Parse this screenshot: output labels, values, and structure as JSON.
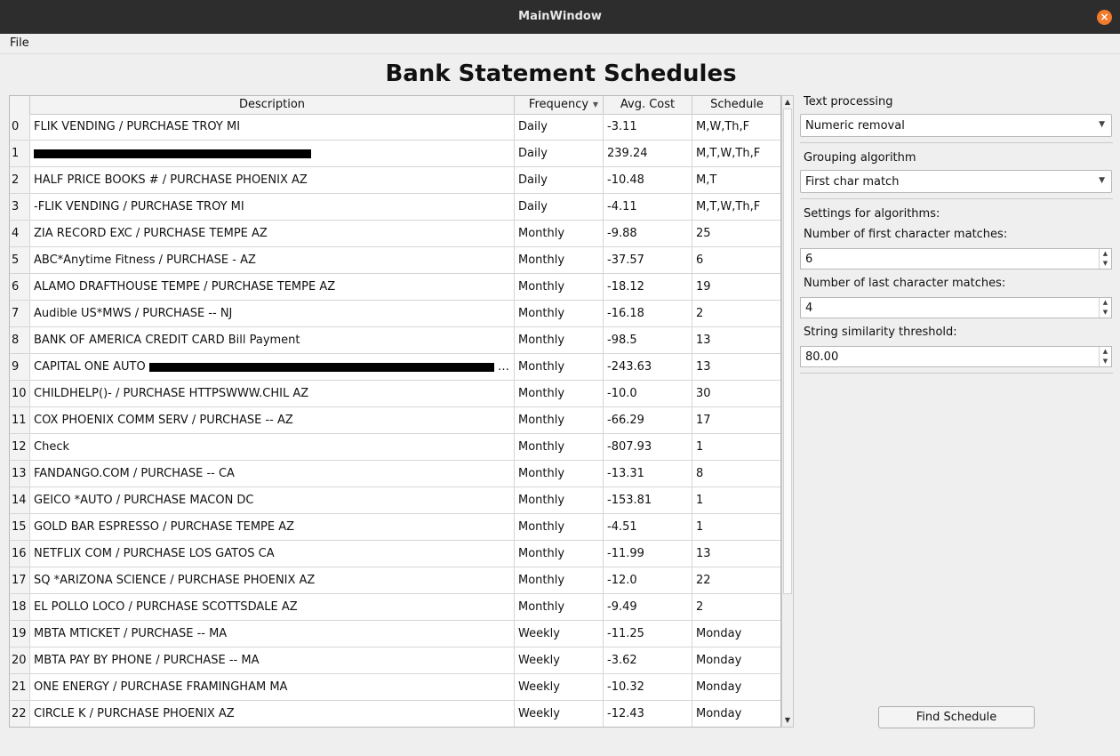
{
  "window": {
    "title": "MainWindow",
    "close_glyph": "×"
  },
  "menu": {
    "file_label": "File"
  },
  "page_title": "Bank Statement Schedules",
  "table": {
    "columns": [
      "Description",
      "Frequency",
      "Avg. Cost",
      "Schedule"
    ],
    "rows": [
      {
        "index": "0",
        "description": "FLIK VENDING / PURCHASE TROY MI",
        "frequency": "Daily",
        "avg_cost": "-3.11",
        "schedule": "M,W,Th,F"
      },
      {
        "index": "1",
        "description": "",
        "frequency": "Daily",
        "avg_cost": "239.24",
        "schedule": "M,T,W,Th,F"
      },
      {
        "index": "2",
        "description": "HALF PRICE BOOKS # / PURCHASE PHOENIX AZ",
        "frequency": "Daily",
        "avg_cost": "-10.48",
        "schedule": "M,T"
      },
      {
        "index": "3",
        "description": "-FLIK VENDING / PURCHASE TROY MI",
        "frequency": "Daily",
        "avg_cost": "-4.11",
        "schedule": "M,T,W,Th,F"
      },
      {
        "index": "4",
        "description": "ZIA RECORD EXC / PURCHASE TEMPE AZ",
        "frequency": "Monthly",
        "avg_cost": "-9.88",
        "schedule": "25"
      },
      {
        "index": "5",
        "description": "ABC*Anytime Fitness / PURCHASE - AZ",
        "frequency": "Monthly",
        "avg_cost": "-37.57",
        "schedule": "6"
      },
      {
        "index": "6",
        "description": "ALAMO DRAFTHOUSE TEMPE / PURCHASE TEMPE AZ",
        "frequency": "Monthly",
        "avg_cost": "-18.12",
        "schedule": "19"
      },
      {
        "index": "7",
        "description": "Audible US*MWS / PURCHASE -- NJ",
        "frequency": "Monthly",
        "avg_cost": "-16.18",
        "schedule": "2"
      },
      {
        "index": "8",
        "description": "BANK OF AMERICA CREDIT CARD Bill Payment",
        "frequency": "Monthly",
        "avg_cost": "-98.5",
        "schedule": "13"
      },
      {
        "index": "9",
        "description": "CAPITAL ONE AUTO",
        "frequency": "Monthly",
        "avg_cost": "-243.63",
        "schedule": "13"
      },
      {
        "index": "10",
        "description": "CHILDHELP()- / PURCHASE HTTPSWWW.CHIL AZ",
        "frequency": "Monthly",
        "avg_cost": "-10.0",
        "schedule": "30"
      },
      {
        "index": "11",
        "description": "COX PHOENIX COMM SERV / PURCHASE -- AZ",
        "frequency": "Monthly",
        "avg_cost": "-66.29",
        "schedule": "17"
      },
      {
        "index": "12",
        "description": "Check",
        "frequency": "Monthly",
        "avg_cost": "-807.93",
        "schedule": "1"
      },
      {
        "index": "13",
        "description": "FANDANGO.COM / PURCHASE -- CA",
        "frequency": "Monthly",
        "avg_cost": "-13.31",
        "schedule": "8"
      },
      {
        "index": "14",
        "description": "GEICO *AUTO / PURCHASE MACON DC",
        "frequency": "Monthly",
        "avg_cost": "-153.81",
        "schedule": "1"
      },
      {
        "index": "15",
        "description": "GOLD BAR ESPRESSO / PURCHASE TEMPE AZ",
        "frequency": "Monthly",
        "avg_cost": "-4.51",
        "schedule": "1"
      },
      {
        "index": "16",
        "description": "NETFLIX COM / PURCHASE LOS GATOS CA",
        "frequency": "Monthly",
        "avg_cost": "-11.99",
        "schedule": "13"
      },
      {
        "index": "17",
        "description": "SQ *ARIZONA SCIENCE / PURCHASE PHOENIX AZ",
        "frequency": "Monthly",
        "avg_cost": "-12.0",
        "schedule": "22"
      },
      {
        "index": "18",
        "description": " EL POLLO LOCO / PURCHASE SCOTTSDALE AZ",
        "frequency": "Monthly",
        "avg_cost": "-9.49",
        "schedule": "2"
      },
      {
        "index": "19",
        "description": "MBTA MTICKET / PURCHASE -- MA",
        "frequency": "Weekly",
        "avg_cost": "-11.25",
        "schedule": "Monday"
      },
      {
        "index": "20",
        "description": "MBTA PAY BY PHONE / PURCHASE -- MA",
        "frequency": "Weekly",
        "avg_cost": "-3.62",
        "schedule": "Monday"
      },
      {
        "index": "21",
        "description": "ONE ENERGY / PURCHASE FRAMINGHAM MA",
        "frequency": "Weekly",
        "avg_cost": "-10.32",
        "schedule": "Monday"
      },
      {
        "index": "22",
        "description": "CIRCLE K  / PURCHASE PHOENIX AZ",
        "frequency": "Weekly",
        "avg_cost": "-12.43",
        "schedule": "Monday"
      }
    ]
  },
  "settings": {
    "text_processing_label": "Text processing",
    "text_processing_value": "Numeric removal",
    "grouping_label": "Grouping algorithm",
    "grouping_value": "First char match",
    "settings_label": "Settings for algorithms:",
    "first_char_label": "Number of first character matches:",
    "first_char_value": "6",
    "last_char_label": "Number of last character matches:",
    "last_char_value": "4",
    "similarity_label": "String similarity threshold:",
    "similarity_value": "80.00"
  },
  "actions": {
    "find_schedule_label": "Find Schedule"
  },
  "colors": {
    "titlebar": "#2d2d2d",
    "close_button": "#f27b2b"
  }
}
